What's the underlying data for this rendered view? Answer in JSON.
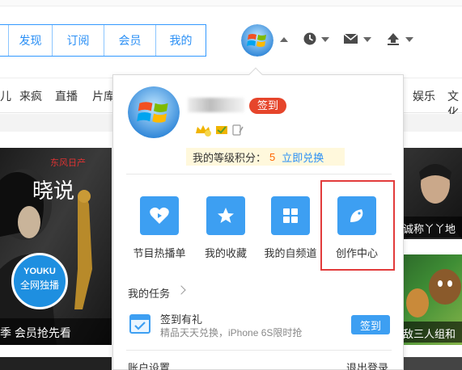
{
  "header": {
    "nav_tabs": [
      "",
      "发现",
      "订阅",
      "会员",
      "我的"
    ]
  },
  "icons": {
    "avatar": "windows-logo-avatar",
    "history": "clock-icon",
    "messages": "envelope-icon",
    "upload": "upload-icon"
  },
  "categories": [
    "儿",
    "来疯",
    "直播",
    "片库",
    "娱乐",
    "文化"
  ],
  "left_banner": {
    "caption": "季 会员抢先看",
    "badge_line1": "YOUKU",
    "badge_line2": "全网独播"
  },
  "right_thumbs": {
    "caption1": "诚称丫丫地",
    "caption2": "敌三人组和"
  },
  "dropdown": {
    "signin_badge": "签到",
    "points_label": "我的等级积分：",
    "points_value": "5",
    "points_exchange": "立即兑换",
    "tiles": [
      {
        "label": "节目热播单",
        "icon": "heart-play-icon"
      },
      {
        "label": "我的收藏",
        "icon": "star-icon"
      },
      {
        "label": "我的自频道",
        "icon": "grid-icon"
      },
      {
        "label": "创作中心",
        "icon": "feather-icon"
      }
    ],
    "tasks_title": "我的任务",
    "task": {
      "name": "签到有礼",
      "desc": "精品天天兑换，iPhone 6S限时抢",
      "button": "签到"
    },
    "account_settings": "账户设置",
    "logout": "退出登录"
  },
  "colors": {
    "accent": "#3d9ff2",
    "nav_blue": "#2a8ff5",
    "signin_red": "#e6452b",
    "points_orange": "#ff6600",
    "highlight_red": "#e23b3b"
  }
}
